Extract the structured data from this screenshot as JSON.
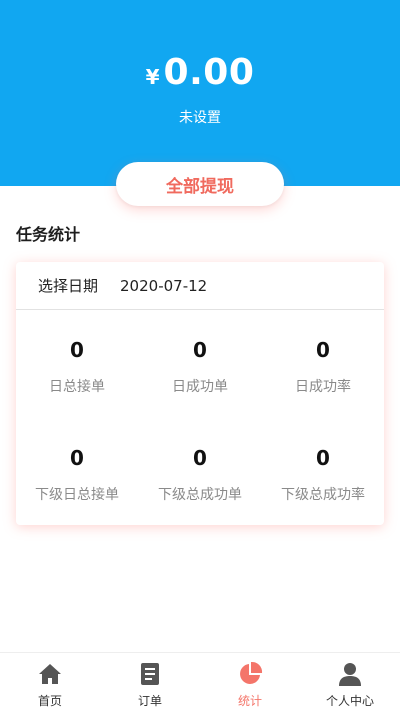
{
  "header": {
    "currency_symbol": "¥",
    "amount": "0.00",
    "subtitle": "未设置",
    "background_color": "#11a7f1"
  },
  "withdraw_button": {
    "label": "全部提现",
    "color": "#f06a5e"
  },
  "task_stats": {
    "title": "任务统计",
    "date_label": "选择日期",
    "date_value": "2020-07-12",
    "stats": [
      {
        "value": "0",
        "label": "日总接单"
      },
      {
        "value": "0",
        "label": "日成功单"
      },
      {
        "value": "0",
        "label": "日成功率"
      },
      {
        "value": "0",
        "label": "下级日总接单"
      },
      {
        "value": "0",
        "label": "下级总成功单"
      },
      {
        "value": "0",
        "label": "下级总成功率"
      }
    ]
  },
  "bottom_nav": {
    "active_color": "#f4756a",
    "items": [
      {
        "label": "首页",
        "icon": "home-icon"
      },
      {
        "label": "订单",
        "icon": "order-icon"
      },
      {
        "label": "统计",
        "icon": "pie-chart-icon",
        "active": true
      },
      {
        "label": "个人中心",
        "icon": "user-icon"
      }
    ]
  }
}
